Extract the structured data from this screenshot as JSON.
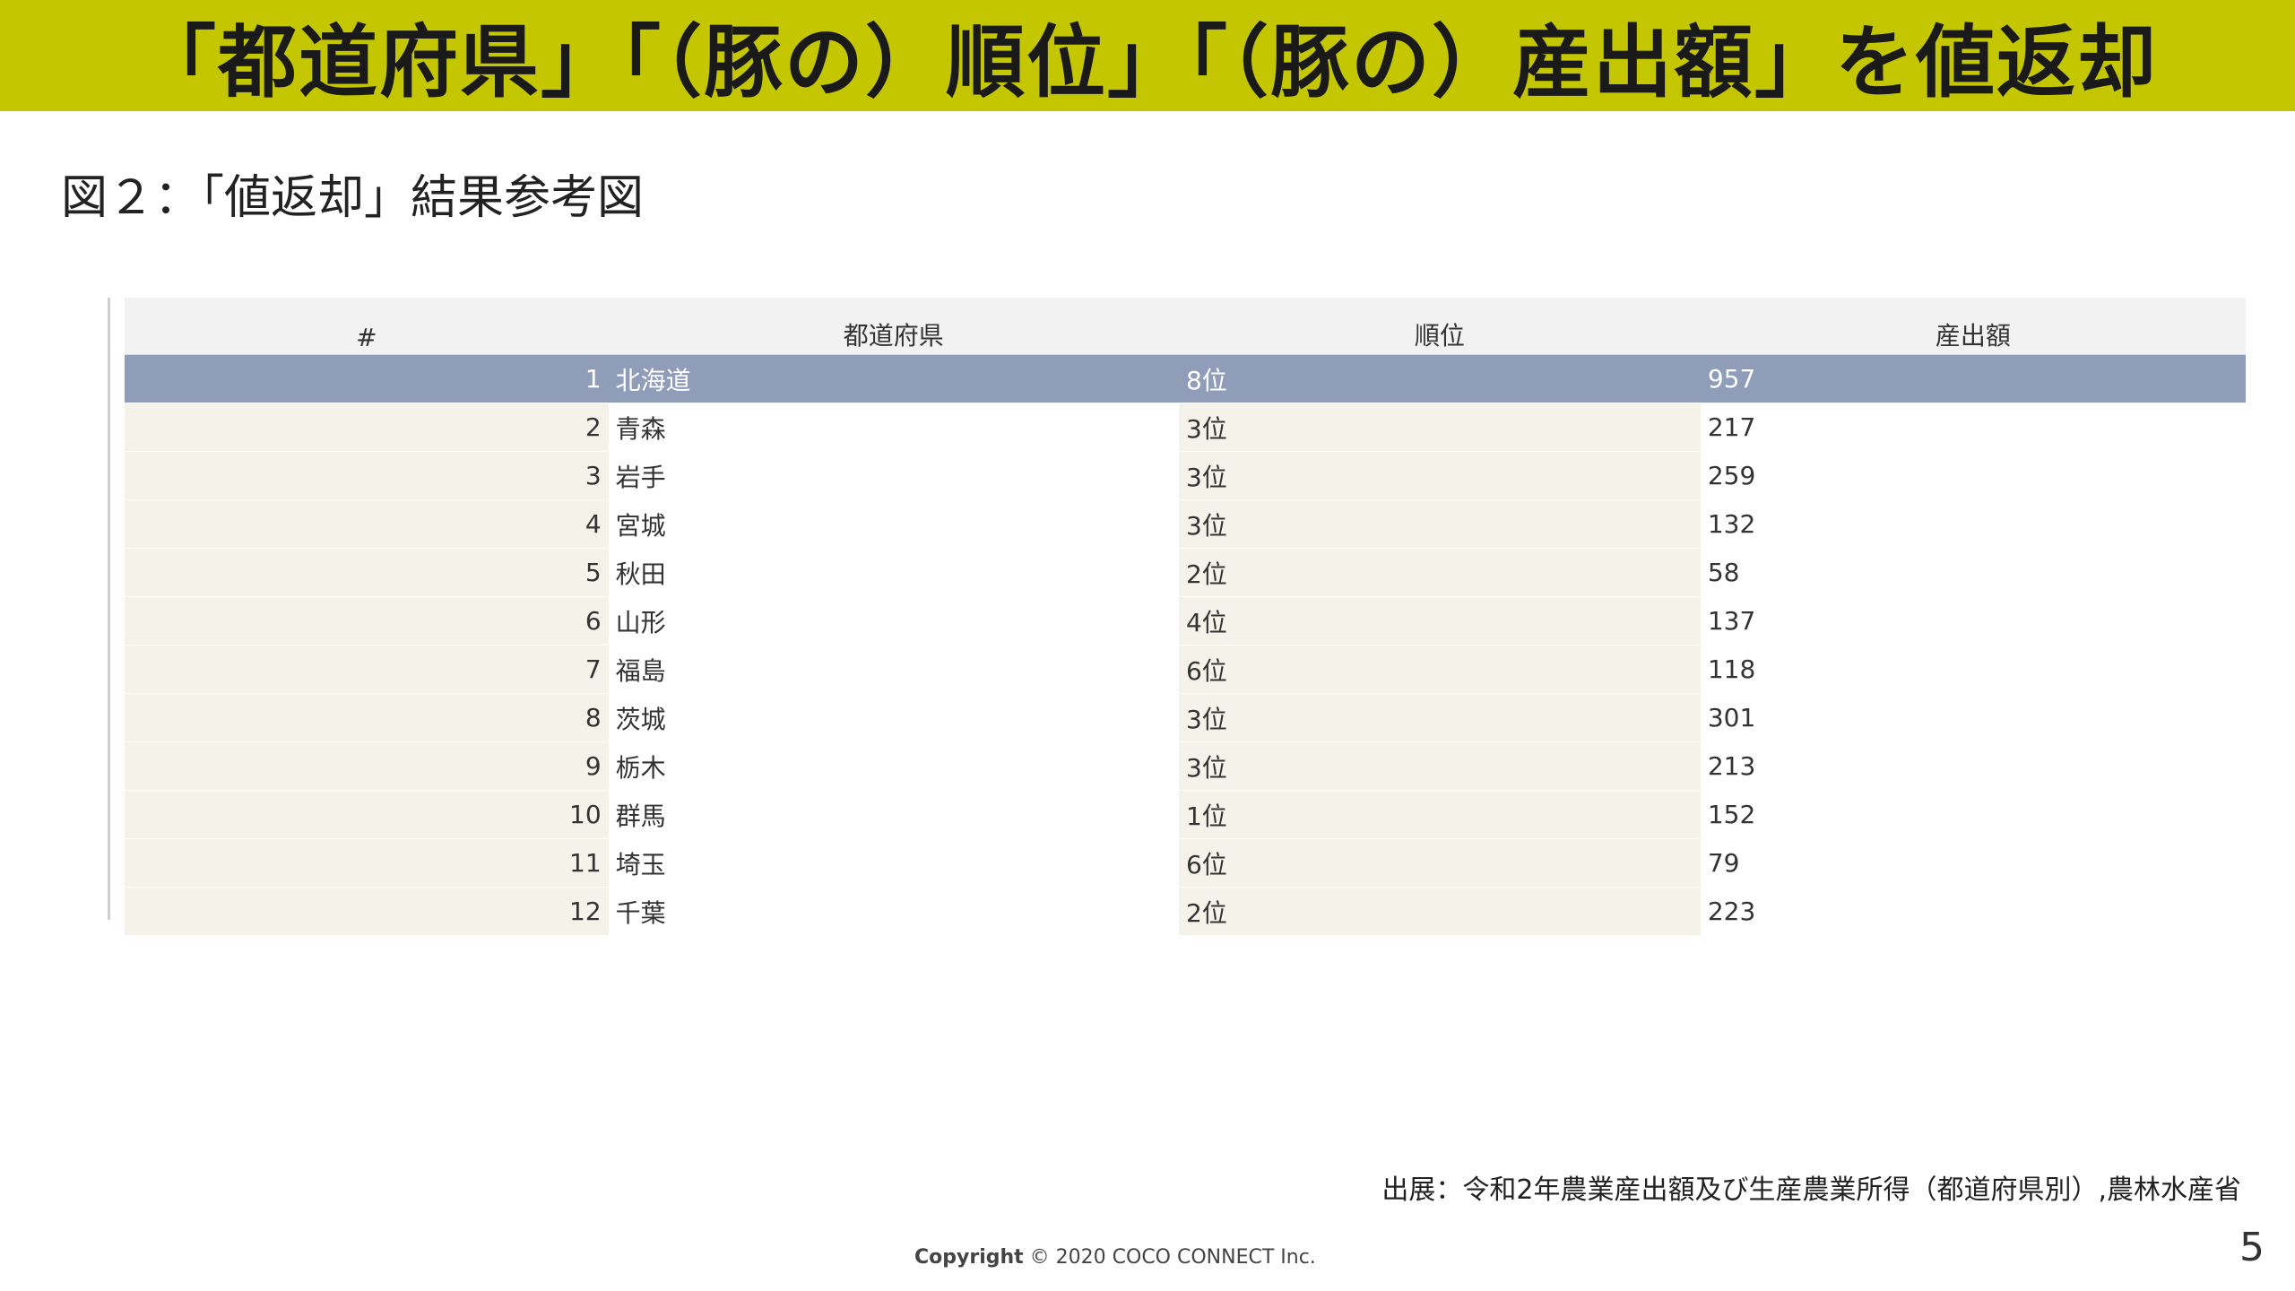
{
  "banner": {
    "title": "「都道府県」「（豚の）順位」「（豚の）産出額」を値返却"
  },
  "figure": {
    "caption": "図２：「値返却」結果参考図"
  },
  "table": {
    "headers": [
      "#",
      "都道府県",
      "順位",
      "産出額"
    ],
    "selected_row": 1,
    "rows": [
      {
        "idx": "1",
        "pref": "北海道",
        "rank": "8位",
        "output": "957"
      },
      {
        "idx": "2",
        "pref": "青森",
        "rank": "3位",
        "output": "217"
      },
      {
        "idx": "3",
        "pref": "岩手",
        "rank": "3位",
        "output": "259"
      },
      {
        "idx": "4",
        "pref": "宮城",
        "rank": "3位",
        "output": "132"
      },
      {
        "idx": "5",
        "pref": "秋田",
        "rank": "2位",
        "output": "58"
      },
      {
        "idx": "6",
        "pref": "山形",
        "rank": "4位",
        "output": "137"
      },
      {
        "idx": "7",
        "pref": "福島",
        "rank": "6位",
        "output": "118"
      },
      {
        "idx": "8",
        "pref": "茨城",
        "rank": "3位",
        "output": "301"
      },
      {
        "idx": "9",
        "pref": "栃木",
        "rank": "3位",
        "output": "213"
      },
      {
        "idx": "10",
        "pref": "群馬",
        "rank": "1位",
        "output": "152"
      },
      {
        "idx": "11",
        "pref": "埼玉",
        "rank": "6位",
        "output": "79"
      },
      {
        "idx": "12",
        "pref": "千葉",
        "rank": "2位",
        "output": "223"
      }
    ]
  },
  "footer": {
    "source": "出展：令和2年農業産出額及び生産農業所得（都道府県別）,農林水産省",
    "copyright_label": "Copyright",
    "copyright_text": "© 2020 COCO CONNECT Inc.",
    "page_number": "5"
  },
  "colors": {
    "banner": "#c4c700",
    "selected_row": "#8f9db8",
    "alt_column": "#f5f2ea"
  }
}
